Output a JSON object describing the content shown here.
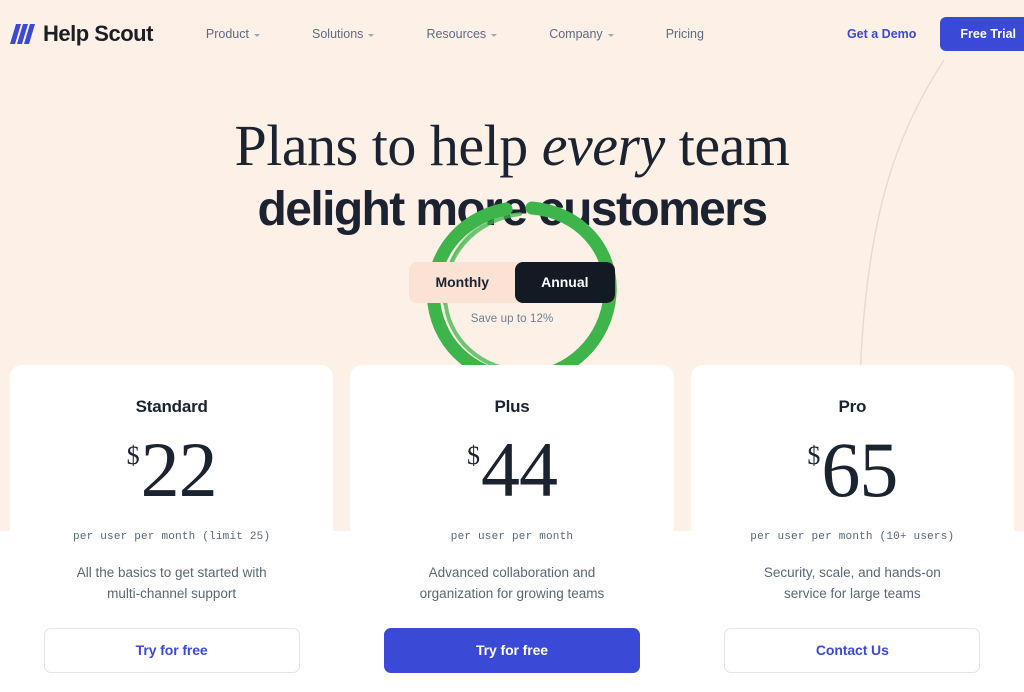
{
  "brand": {
    "name": "Help Scout",
    "logo_icon": "help-scout-slashes-icon",
    "accent_blue": "#3A49D6",
    "hero_bg": "#FDF0E7",
    "annotation_green": "#3DB54A"
  },
  "nav": {
    "links": [
      {
        "label": "Product",
        "has_caret": true
      },
      {
        "label": "Solutions",
        "has_caret": true
      },
      {
        "label": "Resources",
        "has_caret": true
      },
      {
        "label": "Company",
        "has_caret": true
      },
      {
        "label": "Pricing",
        "has_caret": false
      }
    ],
    "demo_label": "Get a Demo",
    "trial_label": "Free Trial"
  },
  "hero": {
    "headline_line1_pre": "Plans to help ",
    "headline_line1_em": "every",
    "headline_line1_post": " team",
    "headline_line2": "delight more customers"
  },
  "billing": {
    "monthly_label": "Monthly",
    "annual_label": "Annual",
    "selected": "Annual",
    "save_note": "Save up to 12%"
  },
  "plans": [
    {
      "name": "Standard",
      "currency": "$",
      "amount": "22",
      "meta": "per user per month (limit 25)",
      "desc": "All the basics to get started with multi-channel support",
      "cta_label": "Try for free",
      "cta_style": "outline"
    },
    {
      "name": "Plus",
      "currency": "$",
      "amount": "44",
      "meta": "per user per month",
      "desc": "Advanced collaboration and organization for growing teams",
      "cta_label": "Try for free",
      "cta_style": "filled"
    },
    {
      "name": "Pro",
      "currency": "$",
      "amount": "65",
      "meta": "per user per month (10+ users)",
      "desc": "Security, scale, and hands-on service for large teams",
      "cta_label": "Contact Us",
      "cta_style": "outline"
    }
  ]
}
